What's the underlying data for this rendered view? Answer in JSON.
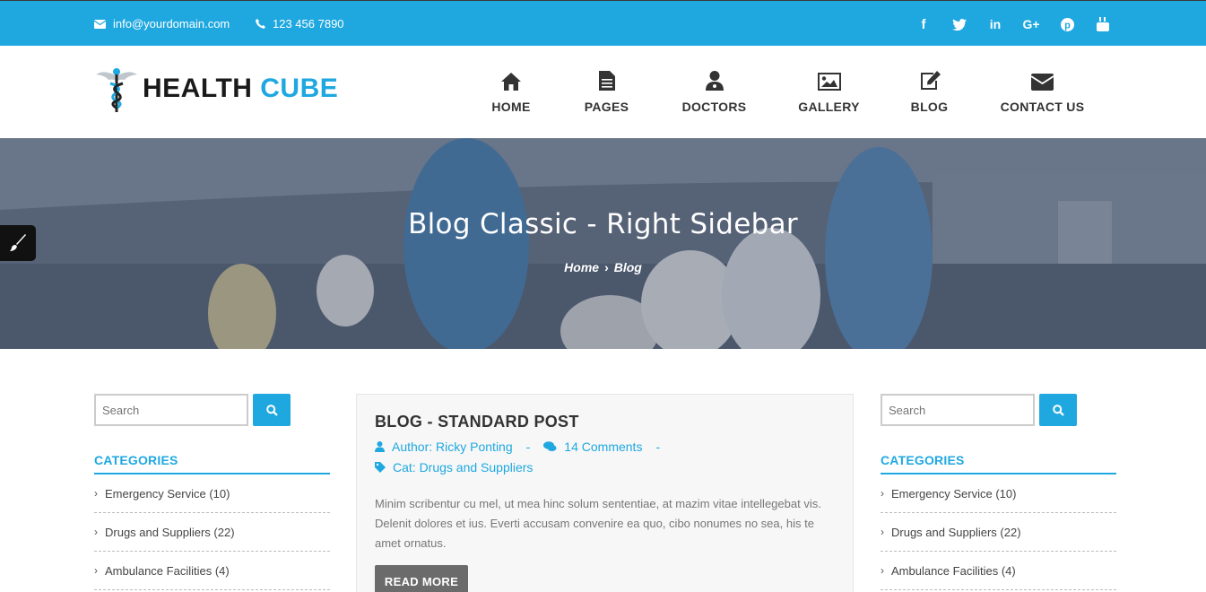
{
  "topbar": {
    "email": "info@yourdomain.com",
    "phone": "123 456 7890",
    "socials": [
      "facebook-icon",
      "twitter-icon",
      "linkedin-icon",
      "google-plus-icon",
      "pinterest-icon",
      "youtube-icon"
    ],
    "color": "#1fa8e0"
  },
  "logo": {
    "part1": "HEALTH ",
    "part2": "CUBE"
  },
  "nav": [
    {
      "label": "HOME",
      "icon": "home-icon"
    },
    {
      "label": "PAGES",
      "icon": "file-icon"
    },
    {
      "label": "DOCTORS",
      "icon": "doctor-icon"
    },
    {
      "label": "GALLERY",
      "icon": "image-icon"
    },
    {
      "label": "BLOG",
      "icon": "edit-icon"
    },
    {
      "label": "CONTACT US",
      "icon": "envelope-icon"
    }
  ],
  "hero": {
    "title": "Blog Classic - Right Sidebar",
    "breadcrumb": {
      "home": "Home",
      "sep": "›",
      "current": "Blog"
    }
  },
  "sidebar": {
    "search_placeholder": "Search",
    "categories_title": "CATEGORIES",
    "categories": [
      "Emergency Service (10)",
      "Drugs and Suppliers (22)",
      "Ambulance Facilities (4)"
    ]
  },
  "post": {
    "title": "BLOG - STANDARD POST",
    "author": "Author: Ricky Ponting",
    "comments": "14 Comments",
    "dash": "-",
    "category": "Cat: Drugs and Suppliers",
    "excerpt": "Minim scribentur cu mel, ut mea hinc solum sententiae, at mazim vitae intellegebat vis. Delenit dolores et ius. Everti accusam convenire ea quo, cibo nonumes no sea, his te amet ornatus.",
    "read_more": "READ MORE"
  }
}
